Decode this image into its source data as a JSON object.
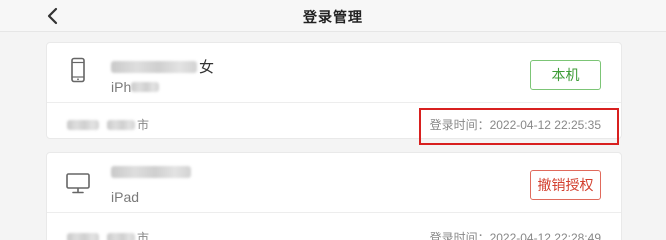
{
  "nav": {
    "title": "登录管理",
    "back_icon": "chevron-left-icon"
  },
  "devices": [
    {
      "name_suffix": "女",
      "model_visible": "iPh",
      "device_icon": "phone-icon",
      "button_label": "本机",
      "location_suffix": "市",
      "login_time": "登录时间：2022-04-12 22:25:35"
    },
    {
      "name_suffix": "",
      "model_visible": "iPad",
      "device_icon": "desktop-icon",
      "button_label": "撤销授权",
      "location_suffix": "市",
      "login_time": "登录时间：2022-04-12 22:28:49"
    }
  ],
  "colors": {
    "local_green": "#3e9c37",
    "revoke_red": "#d3402f",
    "highlight_red": "#d8201f"
  }
}
